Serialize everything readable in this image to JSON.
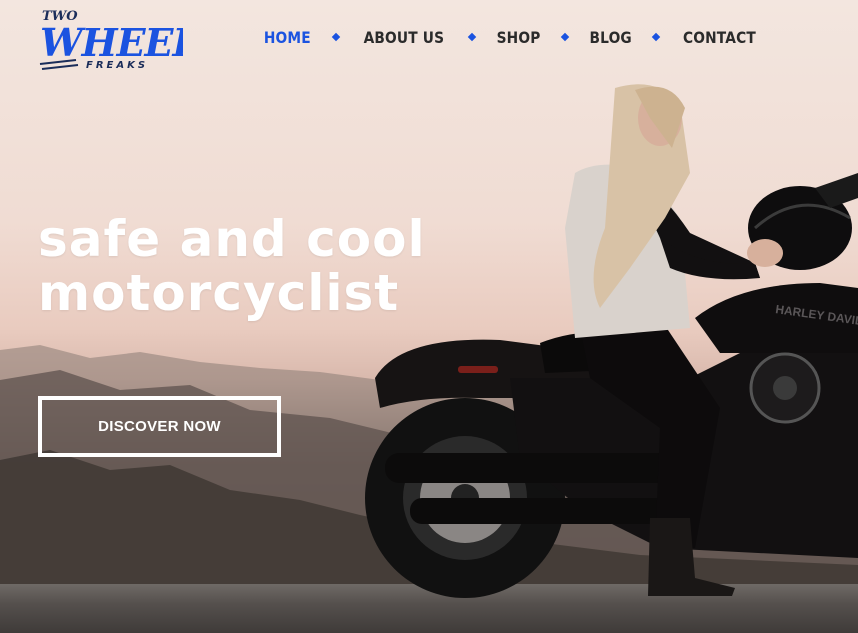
{
  "brand": {
    "logo_top": "TWO",
    "logo_main": "WHEELS",
    "logo_sub": "FREAKS",
    "accent_color": "#1b53e0"
  },
  "nav": {
    "items": [
      {
        "label": "HOME",
        "active": true
      },
      {
        "label": "ABOUT US",
        "active": false
      },
      {
        "label": "SHOP",
        "active": false
      },
      {
        "label": "BLOG",
        "active": false
      },
      {
        "label": "CONTACT",
        "active": false
      }
    ]
  },
  "hero": {
    "headline_line1": "safe and cool",
    "headline_line2": "motorcyclist",
    "cta_label": "DISCOVER NOW",
    "bike_tank_text": "HARLEY DAVIDSON"
  }
}
